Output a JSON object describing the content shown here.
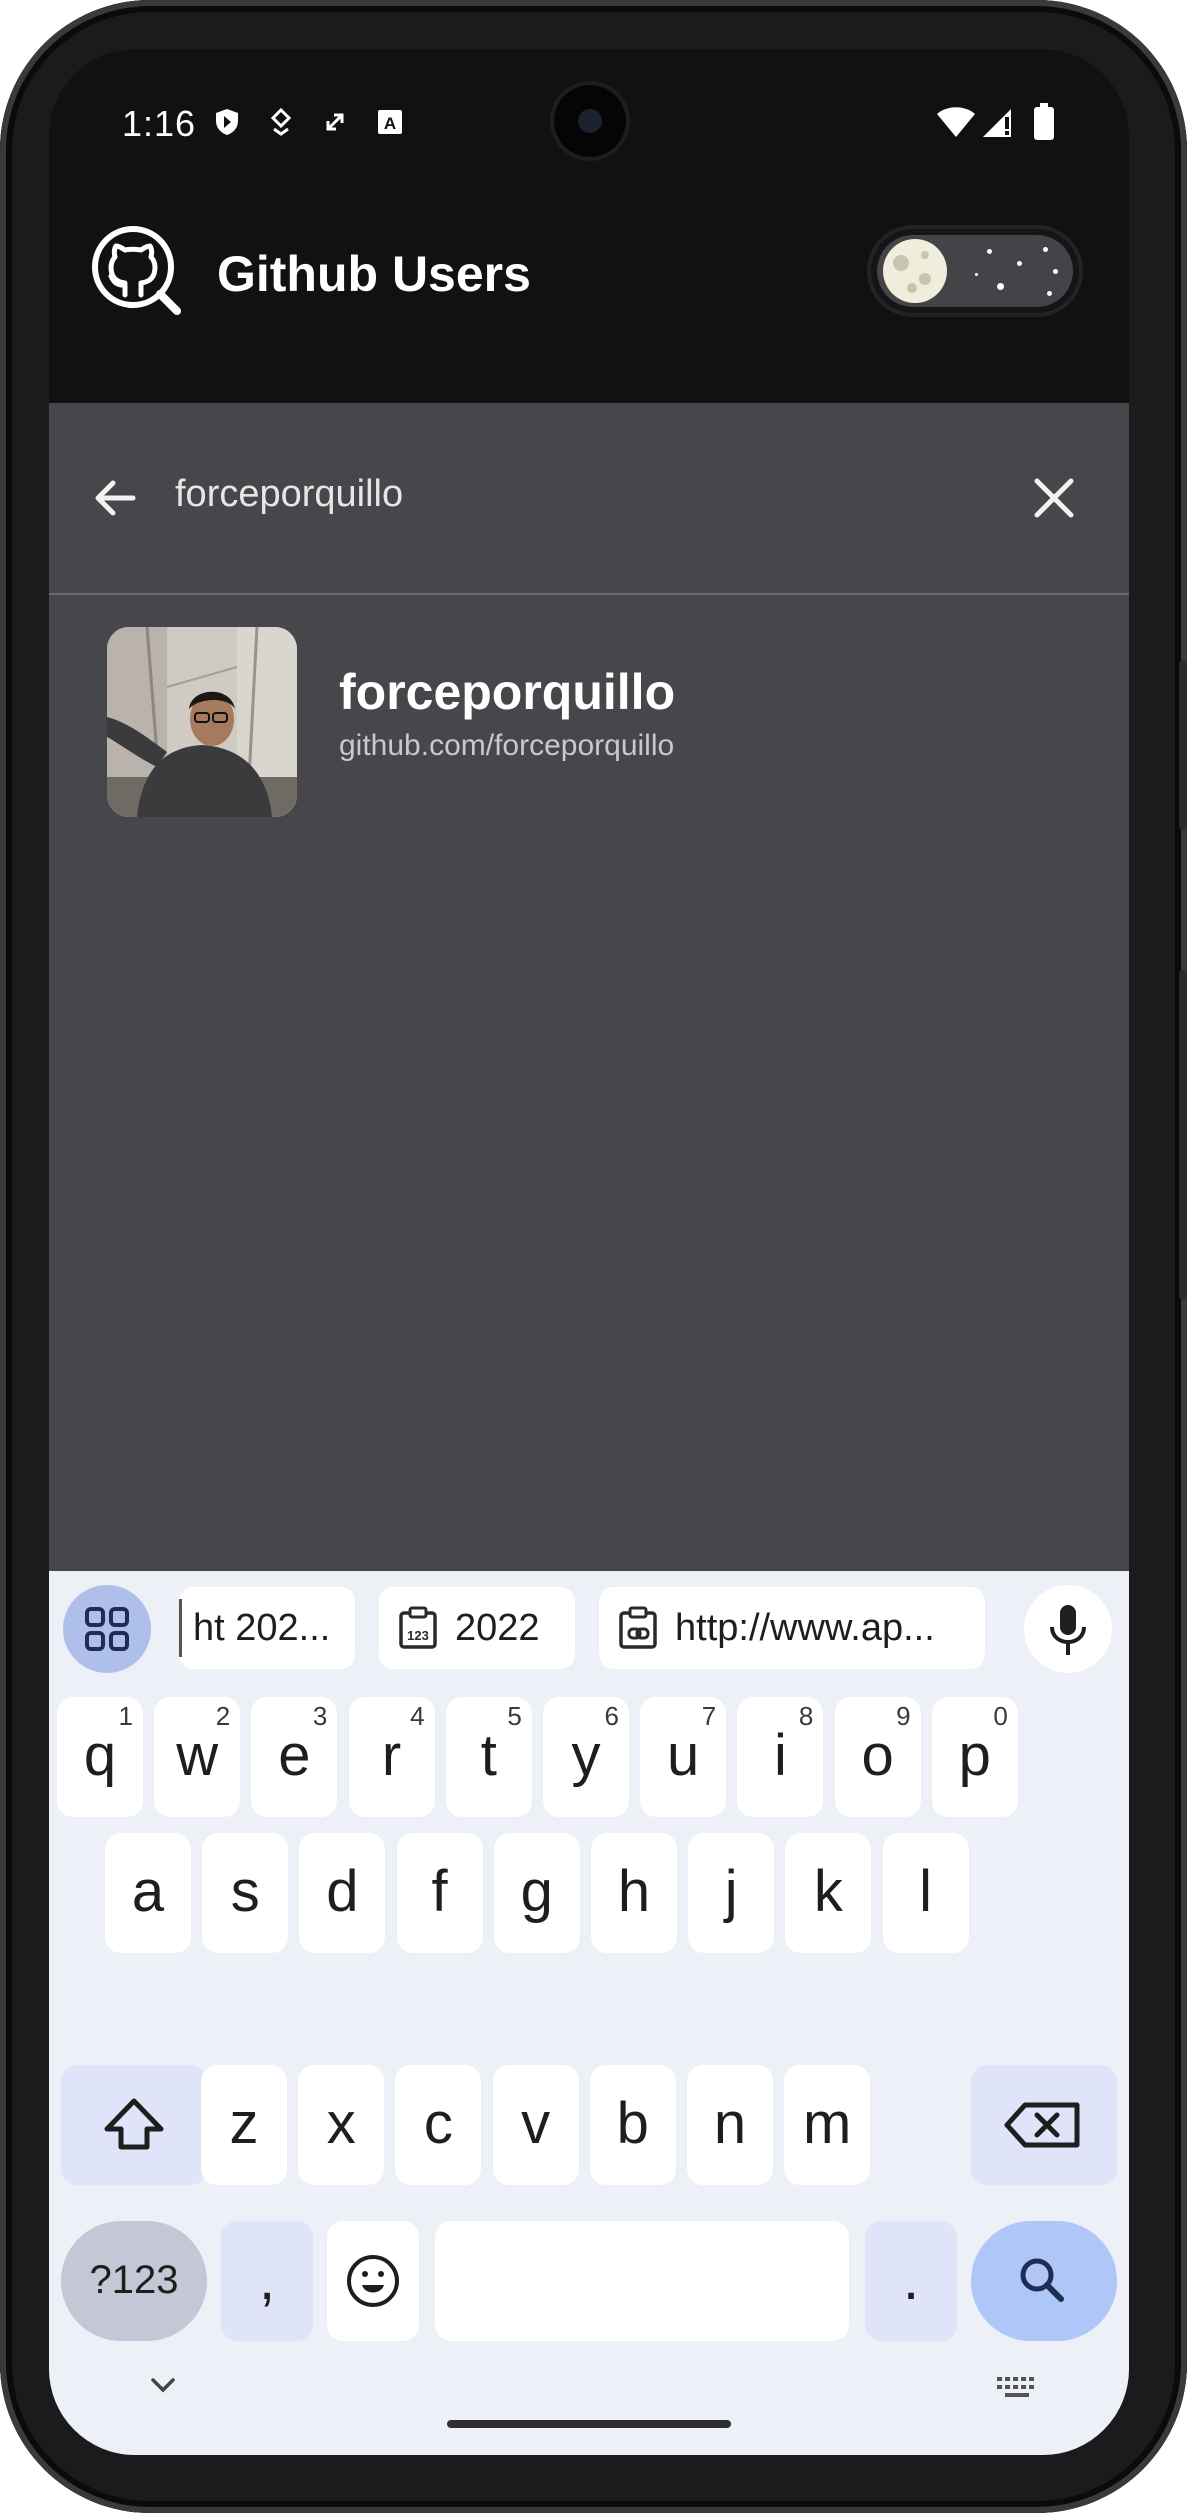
{
  "status_bar": {
    "time": "1:16"
  },
  "app_bar": {
    "title": "Github Users",
    "dark_mode_toggle": "on"
  },
  "search": {
    "query": "forceporquillo"
  },
  "results": [
    {
      "username": "forceporquillo",
      "url": "github.com/forceporquillo"
    }
  ],
  "keyboard": {
    "suggestions": [
      "ht 202...",
      "2022",
      "http://www.ap..."
    ],
    "row1": [
      {
        "key": "q",
        "hint": "1"
      },
      {
        "key": "w",
        "hint": "2"
      },
      {
        "key": "e",
        "hint": "3"
      },
      {
        "key": "r",
        "hint": "4"
      },
      {
        "key": "t",
        "hint": "5"
      },
      {
        "key": "y",
        "hint": "6"
      },
      {
        "key": "u",
        "hint": "7"
      },
      {
        "key": "i",
        "hint": "8"
      },
      {
        "key": "o",
        "hint": "9"
      },
      {
        "key": "p",
        "hint": "0"
      }
    ],
    "row2": [
      "a",
      "s",
      "d",
      "f",
      "g",
      "h",
      "j",
      "k",
      "l"
    ],
    "row3": [
      "z",
      "x",
      "c",
      "v",
      "b",
      "n",
      "m"
    ],
    "symbols_label": "?123",
    "comma": ",",
    "period": "."
  },
  "colors": {
    "app_bar": "#111111",
    "content": "#47474b",
    "keyboard": "#eef0f7",
    "accent": "#aec6f8"
  }
}
